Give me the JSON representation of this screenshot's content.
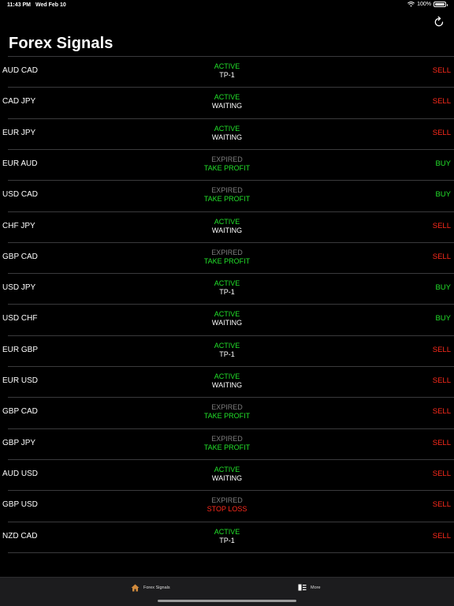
{
  "status_bar": {
    "time": "11:43 PM",
    "date": "Wed Feb 10",
    "battery": "100%"
  },
  "header": {
    "title": "Forex Signals"
  },
  "colors": {
    "green": "#22e02a",
    "red": "#ff2a1c",
    "gray": "#7c7c7c",
    "white": "#ffffff"
  },
  "signals": [
    {
      "pair": "AUD CAD",
      "status": "ACTIVE",
      "result": "TP-1",
      "side": "SELL"
    },
    {
      "pair": "CAD JPY",
      "status": "ACTIVE",
      "result": "WAITING",
      "side": "SELL"
    },
    {
      "pair": "EUR JPY",
      "status": "ACTIVE",
      "result": "WAITING",
      "side": "SELL"
    },
    {
      "pair": "EUR AUD",
      "status": "EXPIRED",
      "result": "TAKE PROFIT",
      "side": "BUY"
    },
    {
      "pair": "USD CAD",
      "status": "EXPIRED",
      "result": "TAKE PROFIT",
      "side": "BUY"
    },
    {
      "pair": "CHF JPY",
      "status": "ACTIVE",
      "result": "WAITING",
      "side": "SELL"
    },
    {
      "pair": "GBP CAD",
      "status": "EXPIRED",
      "result": "TAKE PROFIT",
      "side": "SELL"
    },
    {
      "pair": "USD JPY",
      "status": "ACTIVE",
      "result": "TP-1",
      "side": "BUY"
    },
    {
      "pair": "USD CHF",
      "status": "ACTIVE",
      "result": "WAITING",
      "side": "BUY"
    },
    {
      "pair": "EUR GBP",
      "status": "ACTIVE",
      "result": "TP-1",
      "side": "SELL"
    },
    {
      "pair": "EUR USD",
      "status": "ACTIVE",
      "result": "WAITING",
      "side": "SELL"
    },
    {
      "pair": "GBP CAD",
      "status": "EXPIRED",
      "result": "TAKE PROFIT",
      "side": "SELL"
    },
    {
      "pair": "GBP JPY",
      "status": "EXPIRED",
      "result": "TAKE PROFIT",
      "side": "SELL"
    },
    {
      "pair": "AUD USD",
      "status": "ACTIVE",
      "result": "WAITING",
      "side": "SELL"
    },
    {
      "pair": "GBP USD",
      "status": "EXPIRED",
      "result": "STOP LOSS",
      "side": "SELL"
    },
    {
      "pair": "NZD CAD",
      "status": "ACTIVE",
      "result": "TP-1",
      "side": "SELL"
    }
  ],
  "tab_bar": {
    "tabs": [
      {
        "label": "Forex Signals",
        "icon": "house-icon"
      },
      {
        "label": "More",
        "icon": "book-list-icon"
      }
    ]
  }
}
